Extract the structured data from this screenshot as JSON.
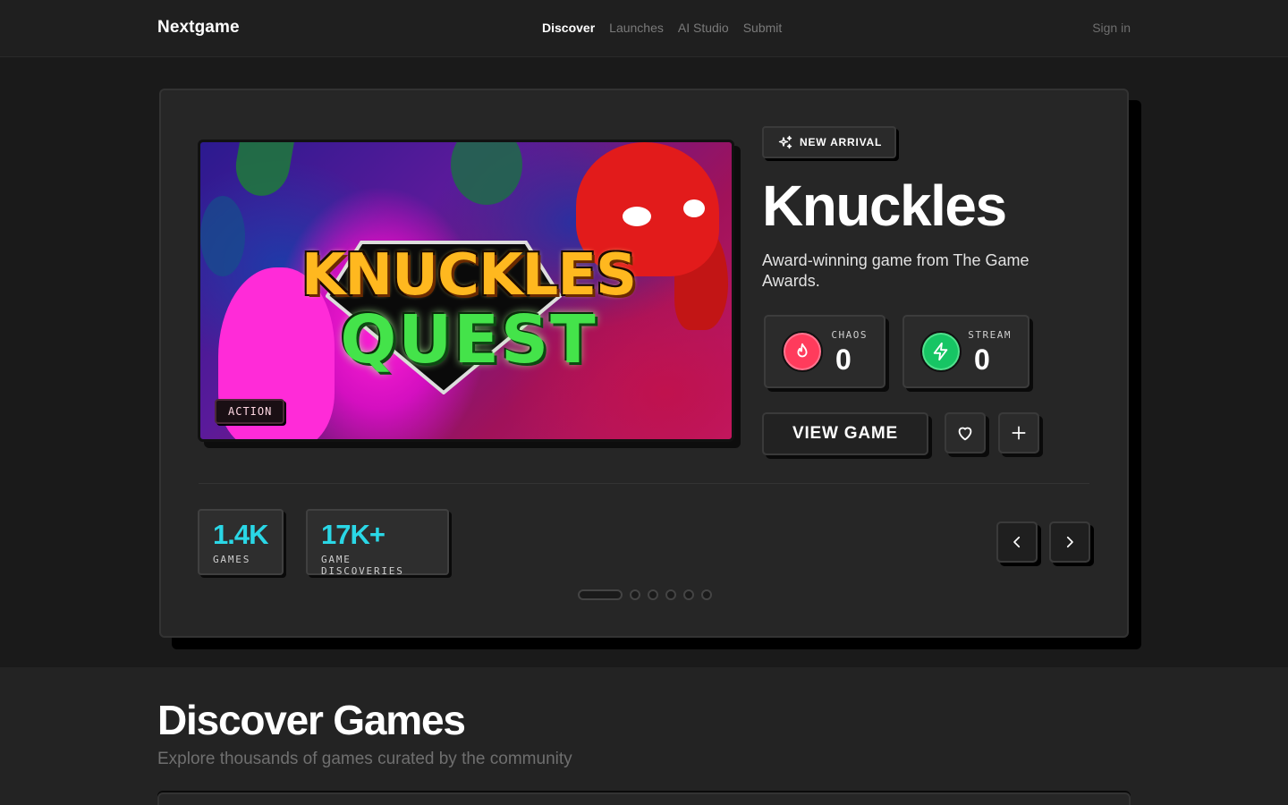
{
  "nav": {
    "brand": "Nextgame",
    "links": [
      "Discover",
      "Launches",
      "AI Studio",
      "Submit"
    ],
    "active": "Discover",
    "signin": "Sign in"
  },
  "hero": {
    "genre_tag": "ACTION",
    "cover_logo_line1": "KNUCKLES",
    "cover_logo_line2": "QUEST",
    "badge": "NEW ARRIVAL",
    "title": "Knuckles",
    "description": "Award-winning game from The Game Awards.",
    "stats": [
      {
        "label": "CHAOS",
        "value": "0",
        "icon": "flame-icon",
        "color": "#ff3b5c"
      },
      {
        "label": "STREAM",
        "value": "0",
        "icon": "bolt-icon",
        "color": "#17c564"
      }
    ],
    "view_button": "VIEW GAME",
    "favorite_icon": "heart-icon",
    "add_icon": "plus-icon",
    "metrics": [
      {
        "value": "1.4K",
        "caption": "GAMES"
      },
      {
        "value": "17K+",
        "caption": "GAME DISCOVERIES"
      }
    ],
    "carousel": {
      "slides": 6,
      "active_index": 0
    }
  },
  "discover": {
    "title": "Discover Games",
    "subtitle": "Explore thousands of games curated by the community"
  },
  "colors": {
    "accent_cyan": "#2ad7e6",
    "chaos_red": "#ff3b5c",
    "stream_green": "#17c564",
    "background": "#1a1a1a"
  }
}
